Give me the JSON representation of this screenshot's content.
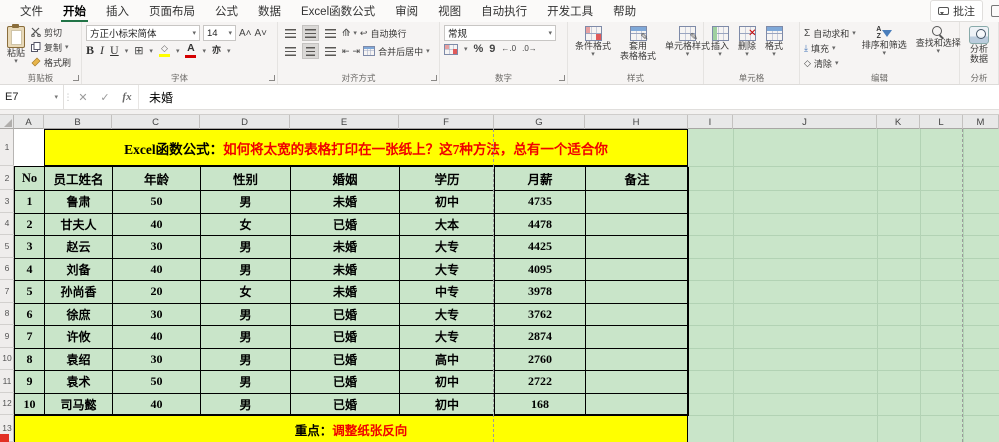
{
  "window": {
    "comments_label": "批注"
  },
  "menu": {
    "active_index": 1,
    "tabs": [
      "文件",
      "开始",
      "插入",
      "页面布局",
      "公式",
      "数据",
      "Excel函数公式",
      "审阅",
      "视图",
      "自动执行",
      "开发工具",
      "帮助"
    ],
    "tab_names": [
      "file",
      "home",
      "insert",
      "page-layout",
      "formulas",
      "data",
      "excel-functions",
      "review",
      "view",
      "automate",
      "developer",
      "help"
    ]
  },
  "ribbon": {
    "paste": "粘贴",
    "cut": "剪切",
    "copy": "复制",
    "format_painter": "格式刷",
    "clipboard_label": "剪贴板",
    "font_family": "方正小标宋简体",
    "font_size": "14",
    "font_label": "字体",
    "bold": "B",
    "italic": "I",
    "underline": "U",
    "wrap_text": "自动换行",
    "merge_center": "合并后居中",
    "align_label": "对齐方式",
    "number_format": "常规",
    "number_label": "数字",
    "percent": "%",
    "comma": "9",
    "dec_inc": "←.0",
    "dec_dec": ".0→",
    "cond_format": "条件格式",
    "table_format_1": "套用",
    "table_format_2": "表格格式",
    "cell_styles": "单元格样式",
    "styles_label": "样式",
    "insert": "插入",
    "delete": "删除",
    "format": "格式",
    "cells_label": "单元格",
    "autosum": "自动求和",
    "fill": "填充",
    "clear": "清除",
    "sort_filter": "排序和筛选",
    "find_select": "查找和选择",
    "edit_label": "编辑",
    "analyze_1": "分析",
    "analyze_2": "数据",
    "analysis_label": "分析",
    "sigma": "Σ"
  },
  "formula_bar": {
    "name_box": "E7",
    "fx_label": "fx",
    "content": "未婚"
  },
  "sheet": {
    "column_letters": [
      "A",
      "B",
      "C",
      "D",
      "E",
      "F",
      "G",
      "H",
      "I",
      "J",
      "K",
      "L",
      "M"
    ],
    "row_numbers": [
      "1",
      "2",
      "3",
      "4",
      "5",
      "6",
      "7",
      "8",
      "9",
      "10",
      "11",
      "12",
      "13"
    ],
    "banner_prefix": "Excel函数公式：",
    "banner_text": "如何将太宽的表格打印在一张纸上？这7种方法，总有一个适合你",
    "footer_prefix": "重点：",
    "footer_text": "调整纸张反向",
    "table": {
      "headers": [
        "No",
        "员工姓名",
        "年龄",
        "性别",
        "婚姻",
        "学历",
        "月薪",
        "备注"
      ],
      "rows": [
        [
          "1",
          "鲁肃",
          "50",
          "男",
          "未婚",
          "初中",
          "4735",
          ""
        ],
        [
          "2",
          "甘夫人",
          "40",
          "女",
          "已婚",
          "大本",
          "4478",
          ""
        ],
        [
          "3",
          "赵云",
          "30",
          "男",
          "未婚",
          "大专",
          "4425",
          ""
        ],
        [
          "4",
          "刘备",
          "40",
          "男",
          "未婚",
          "大专",
          "4095",
          ""
        ],
        [
          "5",
          "孙尚香",
          "20",
          "女",
          "未婚",
          "中专",
          "3978",
          ""
        ],
        [
          "6",
          "徐庶",
          "30",
          "男",
          "已婚",
          "大专",
          "3762",
          ""
        ],
        [
          "7",
          "许攸",
          "40",
          "男",
          "已婚",
          "大专",
          "2874",
          ""
        ],
        [
          "8",
          "袁绍",
          "30",
          "男",
          "已婚",
          "高中",
          "2760",
          ""
        ],
        [
          "9",
          "袁术",
          "50",
          "男",
          "已婚",
          "初中",
          "2722",
          ""
        ],
        [
          "10",
          "司马懿",
          "40",
          "男",
          "已婚",
          "初中",
          "168",
          ""
        ]
      ]
    }
  },
  "colors": {
    "banner_yellow": "#ffff00",
    "text_red": "#f00000",
    "fill_green": "#c9e5c9",
    "accent_green": "#217346",
    "fill_icon_yellow": "#ffd800",
    "font_color_red": "#d40000"
  }
}
